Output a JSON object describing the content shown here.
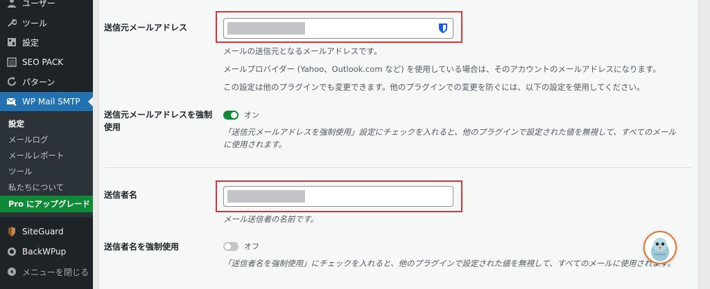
{
  "sidebar": {
    "items": [
      {
        "label": "ユーザー",
        "icon": "user-icon"
      },
      {
        "label": "ツール",
        "icon": "wrench-icon"
      },
      {
        "label": "設定",
        "icon": "settings-icon"
      },
      {
        "label": "SEO PACK",
        "icon": "list-icon"
      },
      {
        "label": "パターン",
        "icon": "refresh-icon"
      },
      {
        "label": "WP Mail SMTP",
        "icon": "mail-icon"
      }
    ],
    "submenu": [
      {
        "label": "設定"
      },
      {
        "label": "メールログ"
      },
      {
        "label": "メールレポート"
      },
      {
        "label": "ツール"
      },
      {
        "label": "私たちについて"
      },
      {
        "label": "Pro にアップグレード"
      }
    ],
    "bottom": [
      {
        "label": "SiteGuard",
        "icon": "siteguard-icon"
      },
      {
        "label": "BackWPup",
        "icon": "backwpup-icon"
      },
      {
        "label": "メニューを閉じる",
        "icon": "collapse-icon"
      }
    ]
  },
  "settings": {
    "from_email": {
      "label": "送信元メールアドレス",
      "value": "",
      "help": [
        "メールの送信元となるメールアドレスです。",
        "メールプロバイダー (Yahoo、Outlook.com など) を使用している場合は、そのアカウントのメールアドレスになります。",
        "この設定は他のプラグインでも変更できます。他のプラグインでの変更を防ぐには、以下の設定を使用してください。"
      ]
    },
    "force_from_email": {
      "label_line1": "送信元メールアドレスを強制",
      "label_line2": "使用",
      "toggle_state": "on",
      "toggle_label": "オン",
      "help_line1": "「送信元メールアドレスを強制使用」設定にチェックを入れると、他のプラグインで設定された値を無視して、すべてのメール",
      "help_line2": "に使用されます。"
    },
    "from_name": {
      "label": "送信者名",
      "value": "",
      "help": "メール送信者の名前です。"
    },
    "force_from_name": {
      "label": "送信者名を強制使用",
      "toggle_state": "off",
      "toggle_label": "オフ",
      "help": "「送信者名を強制使用」にチェックを入れると、他のプラグインで設定された値を無視して、すべてのメールに使用されます。"
    }
  },
  "colors": {
    "accent": "#2271b1",
    "toggle_on": "#0e8a36",
    "highlight": "#d63638",
    "sidebar_bg": "#1d2327"
  }
}
